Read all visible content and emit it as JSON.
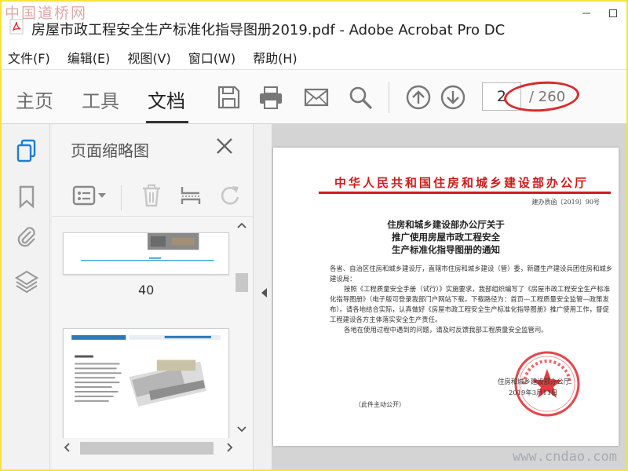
{
  "watermark": {
    "top": "中国道桥网",
    "bottom": "www.cndao.com"
  },
  "window": {
    "title": "房屋市政工程安全生产标准化指导图册2019.pdf - Adobe Acrobat Pro DC"
  },
  "menu": [
    "文件(F)",
    "编辑(E)",
    "视图(V)",
    "窗口(W)",
    "帮助(H)"
  ],
  "tabs": [
    {
      "label": "主页",
      "active": false
    },
    {
      "label": "工具",
      "active": false
    },
    {
      "label": "文档",
      "active": true
    }
  ],
  "toolbar_icons": [
    "save-icon",
    "print-icon",
    "mail-icon",
    "search-icon",
    "page-up-icon",
    "page-down-icon"
  ],
  "page_nav": {
    "current": "2",
    "total": "/ 260"
  },
  "annotation_color": "#d92b2b",
  "accent": "#1a7fd4",
  "thumbnails": {
    "title": "页面缩略图",
    "pages": [
      {
        "label": "40"
      }
    ]
  },
  "document": {
    "issuer": "中华人民共和国住房和城乡建设部办公厅",
    "doc_number": "建办质函〔2019〕90号",
    "heading": [
      "住房和城乡建设部办公厅关于",
      "推广使用房屋市政工程安全",
      "生产标准化指导图册的通知"
    ],
    "body": [
      "各省、自治区住房和城乡建设厅，直辖市住房和城乡建设（管）委，新疆生产建设兵团住房和城乡建设局：",
      "按照《工程质量安全手册（试行）》实施要求，我部组织编写了《房屋市政工程安全生产标准化指导图册》（电子版可登录我部门户网站下载，下载路径为：首页—工程质量安全监管—政策发布）。请各地结合实际，认真做好《房屋市政工程安全生产标准化指导图册》推广使用工作，督促工程建设各方主体落实安全生产责任。",
      "各地在使用过程中遇到的问题，请及时反馈我部工程质量安全监管司。"
    ],
    "signature": "住房和城乡建设部办公厅",
    "date": "2019年3月11日",
    "disclosure": "（此件主动公开）"
  }
}
